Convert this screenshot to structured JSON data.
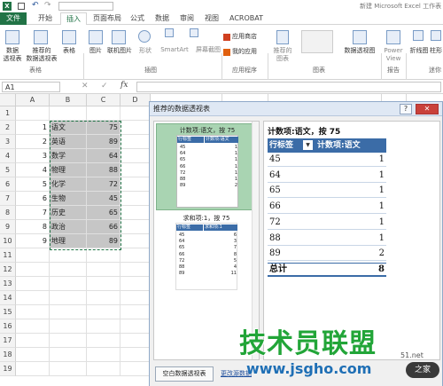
{
  "titlebar": {
    "title": "新建 Microsoft Excel 工作表",
    "quick_access": [
      "save-icon",
      "undo-icon",
      "redo-icon"
    ]
  },
  "tabs": [
    {
      "label": "文件",
      "active": false,
      "file": true
    },
    {
      "label": "开始",
      "active": false
    },
    {
      "label": "插入",
      "active": true
    },
    {
      "label": "页面布局",
      "active": false
    },
    {
      "label": "公式",
      "active": false
    },
    {
      "label": "数据",
      "active": false
    },
    {
      "label": "审阅",
      "active": false
    },
    {
      "label": "视图",
      "active": false
    },
    {
      "label": "ACROBAT",
      "active": false
    }
  ],
  "ribbon": {
    "buttons": [
      {
        "label": "数据\n透视表",
        "icon": "pivot-table-icon"
      },
      {
        "label": "推荐的\n数据透视表",
        "icon": "recommended-pivot-icon"
      },
      {
        "label": "表格",
        "icon": "table-icon"
      },
      {
        "label": "图片",
        "icon": "picture-icon"
      },
      {
        "label": "联机图片",
        "icon": "online-picture-icon"
      },
      {
        "label": "形状",
        "icon": "shapes-icon"
      },
      {
        "label": "SmartArt",
        "icon": "smartart-icon"
      },
      {
        "label": "屏幕截图",
        "icon": "screenshot-icon"
      },
      {
        "label": "应用商店",
        "icon": "store-icon"
      },
      {
        "label": "我的应用",
        "icon": "my-apps-icon"
      },
      {
        "label": "推荐的\n图表",
        "icon": "recommended-chart-icon"
      },
      {
        "label": "数据透视图",
        "icon": "pivot-chart-icon"
      },
      {
        "label": "Power\nView",
        "icon": "power-view-icon"
      },
      {
        "label": "折线图",
        "icon": "line-chart-icon"
      },
      {
        "label": "柱形",
        "icon": "column-chart-icon"
      }
    ],
    "groups": [
      "表格",
      "插图",
      "应用程序",
      "图表",
      "报告",
      "迷你"
    ]
  },
  "formula_bar": {
    "name_box": "A1",
    "fx": "fx",
    "value": ""
  },
  "sheet": {
    "columns": [
      "A",
      "B",
      "C",
      "D"
    ],
    "rows": [
      "1",
      "2",
      "3",
      "4",
      "5",
      "6",
      "7",
      "8",
      "9",
      "10",
      "11",
      "12",
      "13",
      "14",
      "15",
      "16",
      "17",
      "18",
      "19"
    ],
    "data": [
      [
        "1",
        "语文",
        "75"
      ],
      [
        "2",
        "英语",
        "89"
      ],
      [
        "3",
        "数学",
        "64"
      ],
      [
        "4",
        "物理",
        "88"
      ],
      [
        "5",
        "化学",
        "72"
      ],
      [
        "6",
        "生物",
        "45"
      ],
      [
        "7",
        "历史",
        "65"
      ],
      [
        "8",
        "政治",
        "66"
      ],
      [
        "9",
        "地理",
        "89"
      ]
    ]
  },
  "dialog": {
    "title": "推荐的数据透视表",
    "help_btn": "?",
    "close_btn": "✕",
    "options": [
      {
        "caption": "计数项:语文，按 75",
        "selected": true,
        "headers": [
          "行标签",
          "计数项:语文"
        ],
        "rows": [
          [
            "45",
            "1"
          ],
          [
            "64",
            "1"
          ],
          [
            "65",
            "1"
          ],
          [
            "66",
            "1"
          ],
          [
            "72",
            "1"
          ],
          [
            "88",
            "1"
          ],
          [
            "89",
            "2"
          ]
        ]
      },
      {
        "caption": "求和项:1，按 75",
        "selected": false,
        "headers": [
          "行标签",
          "求和项:1"
        ],
        "rows": [
          [
            "45",
            "6"
          ],
          [
            "64",
            "3"
          ],
          [
            "65",
            "7"
          ],
          [
            "66",
            "8"
          ],
          [
            "72",
            "5"
          ],
          [
            "88",
            "4"
          ],
          [
            "89",
            "11"
          ]
        ]
      }
    ],
    "preview": {
      "title": "计数项:语文，按 75",
      "headers": [
        "行标签",
        "计数项:语文"
      ],
      "rows": [
        [
          "45",
          "1"
        ],
        [
          "64",
          "1"
        ],
        [
          "65",
          "1"
        ],
        [
          "66",
          "1"
        ],
        [
          "72",
          "1"
        ],
        [
          "88",
          "1"
        ],
        [
          "89",
          "2"
        ]
      ],
      "total": [
        "总计",
        "8"
      ]
    },
    "blank_pivot_btn": "空白数据透视表",
    "change_source_link": "更改源数据"
  },
  "watermark": {
    "text": "技术员联盟",
    "url": "www.jsgho.com",
    "suffix": "51.net"
  },
  "colors": {
    "accent": "#217346",
    "pivot_header": "#3b6ca7",
    "selected_card": "#a9d4b2",
    "watermark": "#22a538"
  }
}
